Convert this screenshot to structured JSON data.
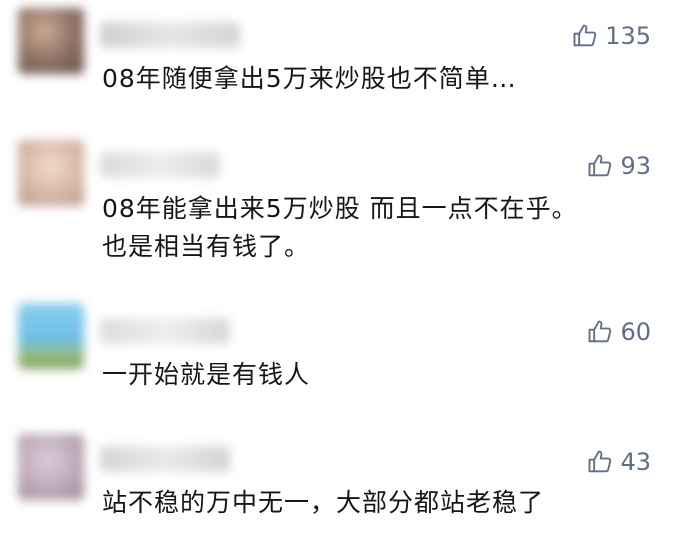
{
  "comments": [
    {
      "likes": "135",
      "text": "08年随便拿出5万来炒股也不简单…",
      "text2": ""
    },
    {
      "likes": "93",
      "text": "08年能拿出来5万炒股 而且一点不在乎。",
      "text2": "也是相当有钱了。"
    },
    {
      "likes": "60",
      "text": "一开始就是有钱人",
      "text2": ""
    },
    {
      "likes": "43",
      "text": "站不稳的万中无一，大部分都站老稳了",
      "text2": ""
    }
  ],
  "icons": {
    "like": "thumbs-up-icon"
  },
  "colors": {
    "like": "#5f6f86",
    "text": "#161616"
  }
}
